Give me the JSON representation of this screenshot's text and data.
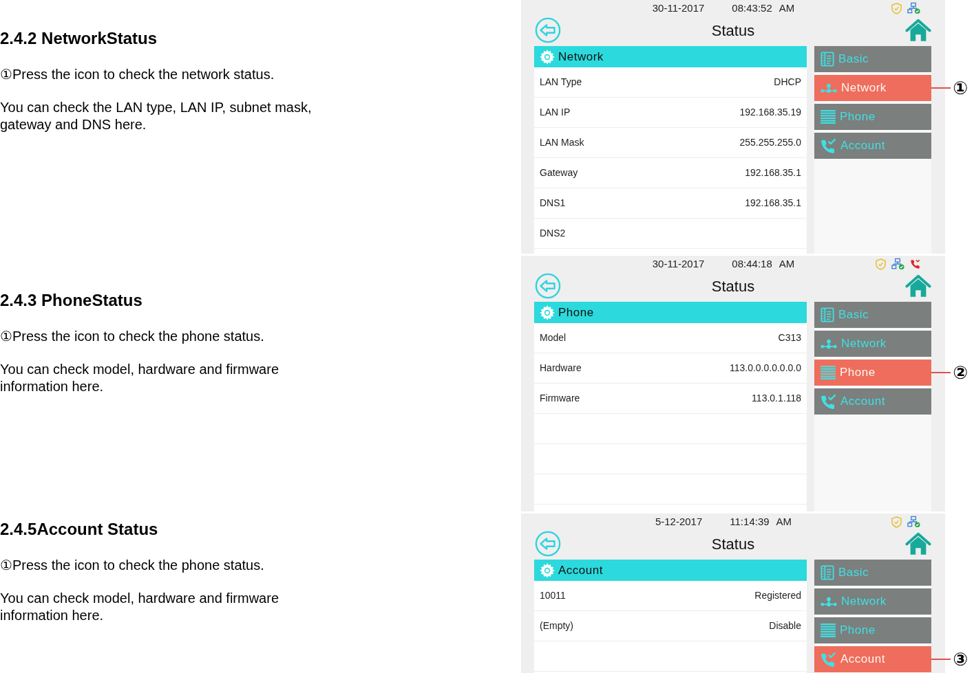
{
  "sections": [
    {
      "heading": "2.4.2 NetworkStatus",
      "step": "①Press the icon to check the network status.",
      "description": "You can check the LAN type, LAN IP, subnet mask, gateway and DNS here.",
      "screen": {
        "date": "30-11-2017",
        "time": "08:43:52",
        "period": "AM",
        "indicators": [
          {
            "kind": "shield"
          },
          {
            "kind": "network"
          }
        ],
        "title": "Status",
        "panel_title": "Network",
        "rows": [
          {
            "label": "LAN Type",
            "value": "DHCP"
          },
          {
            "label": "LAN IP",
            "value": "192.168.35.19"
          },
          {
            "label": "LAN Mask",
            "value": "255.255.255.0"
          },
          {
            "label": "Gateway",
            "value": "192.168.35.1"
          },
          {
            "label": "DNS1",
            "value": "192.168.35.1"
          },
          {
            "label": "DNS2"
          }
        ],
        "menu": [
          {
            "kind": "basic",
            "label": "Basic",
            "selected": false
          },
          {
            "kind": "network",
            "label": "Network",
            "selected": true
          },
          {
            "kind": "phone",
            "label": "Phone",
            "selected": false
          },
          {
            "kind": "account",
            "label": "Account",
            "selected": false
          }
        ]
      },
      "callout": "①"
    },
    {
      "heading": "2.4.3 PhoneStatus",
      "step": "①Press the icon to check the phone status.",
      "description": "You can check model, hardware and firmware information here.",
      "screen": {
        "date": "30-11-2017",
        "time": "08:44:18",
        "period": "AM",
        "indicators": [
          {
            "kind": "shield"
          },
          {
            "kind": "network"
          },
          {
            "kind": "phone"
          }
        ],
        "title": "Status",
        "panel_title": "Phone",
        "rows": [
          {
            "label": "Model",
            "value": "C313"
          },
          {
            "label": "Hardware",
            "value": "113.0.0.0.0.0.0.0"
          },
          {
            "label": "Firmware",
            "value": "113.0.1.118"
          }
        ],
        "menu": [
          {
            "kind": "basic",
            "label": "Basic",
            "selected": false
          },
          {
            "kind": "network",
            "label": "Network",
            "selected": false
          },
          {
            "kind": "phone",
            "label": "Phone",
            "selected": true
          },
          {
            "kind": "account",
            "label": "Account",
            "selected": false
          }
        ]
      },
      "callout": "②"
    },
    {
      "heading": "2.4.5Account Status",
      "step": "①Press the icon to check the phone status.",
      "description": "You can check model, hardware and firmware information here.",
      "screen": {
        "date": "5-12-2017",
        "time": "11:14:39",
        "period": "AM",
        "indicators": [
          {
            "kind": "shield"
          },
          {
            "kind": "network"
          }
        ],
        "title": "Status",
        "panel_title": "Account",
        "rows": [
          {
            "label": "10011",
            "value": "Registered"
          },
          {
            "label": "(Empty)",
            "value": "Disable"
          }
        ],
        "menu": [
          {
            "kind": "basic",
            "label": "Basic",
            "selected": false
          },
          {
            "kind": "network",
            "label": "Network",
            "selected": false
          },
          {
            "kind": "phone",
            "label": "Phone",
            "selected": false
          },
          {
            "kind": "account",
            "label": "Account",
            "selected": true
          }
        ]
      },
      "callout": "③"
    }
  ]
}
